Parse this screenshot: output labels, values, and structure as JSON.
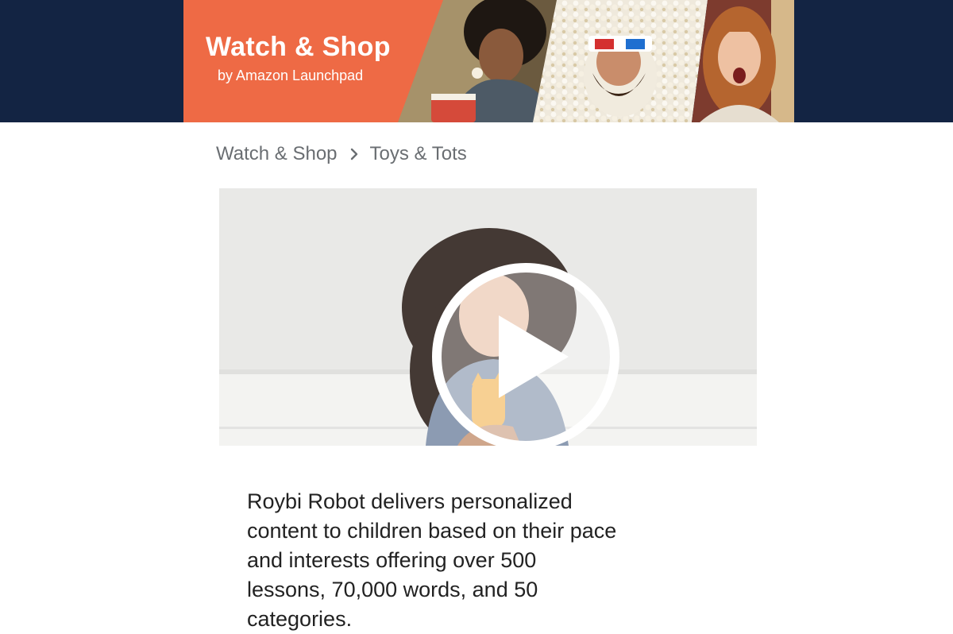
{
  "banner": {
    "title": "Watch & Shop",
    "subtitle": "by Amazon Launchpad",
    "accent_color": "#ee6a45",
    "background_color": "#132443"
  },
  "breadcrumb": {
    "items": [
      "Watch & Shop",
      "Toys & Tots"
    ],
    "separator_icon": "chevron-right-icon"
  },
  "video": {
    "play_icon": "play-icon"
  },
  "description": {
    "text": "Roybi Robot delivers personalized content to children based on their pace and interests offering over 500 lessons, 70,000 words, and 50 categories."
  }
}
